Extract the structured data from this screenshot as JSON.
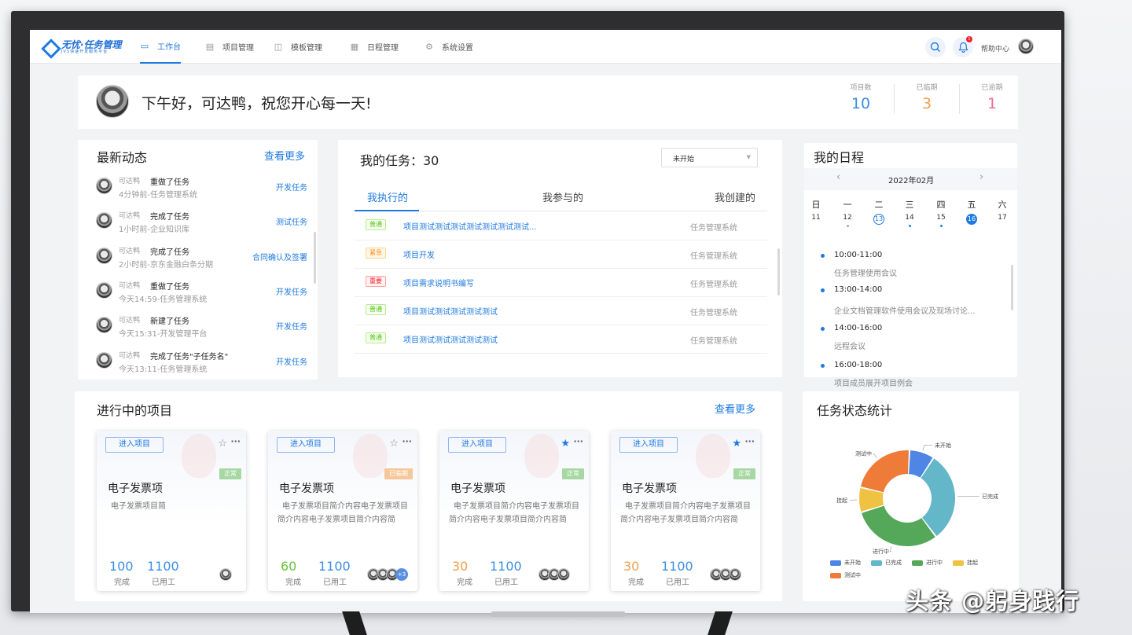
{
  "brand": {
    "name": "无忧·任务管理",
    "sub": "JVS快速开发服务平台"
  },
  "nav": [
    {
      "label": "工作台",
      "icon": "dashboard-icon",
      "active": true
    },
    {
      "label": "项目管理",
      "icon": "clipboard-icon"
    },
    {
      "label": "模板管理",
      "icon": "template-icon"
    },
    {
      "label": "日程管理",
      "icon": "calendar-icon"
    },
    {
      "label": "系统设置",
      "icon": "gear-icon"
    }
  ],
  "header": {
    "help": "帮助中心",
    "notif_count": "1"
  },
  "greeting": {
    "text": "下午好，可达鸭，祝您开心每一天!"
  },
  "stats": [
    {
      "label": "项目数",
      "value": "10",
      "color": "#3a8ee6"
    },
    {
      "label": "已临期",
      "value": "3",
      "color": "#f0a04b"
    },
    {
      "label": "已逾期",
      "value": "1",
      "color": "#f06c8f"
    }
  ],
  "news": {
    "title": "最新动态",
    "more": "查看更多",
    "items": [
      {
        "user": "可达鸭",
        "action": "重做了任务",
        "sub": "4分钟前-任务管理系统",
        "tag": "开发任务"
      },
      {
        "user": "可达鸭",
        "action": "完成了任务",
        "sub": "1小时前-企业知识库",
        "tag": "测试任务"
      },
      {
        "user": "可达鸭",
        "action": "完成了任务",
        "sub": "2小时前-京东金融白条分期",
        "tag": "合同确认及签署"
      },
      {
        "user": "可达鸭",
        "action": "重做了任务",
        "sub": "今天14:59-任务管理系统",
        "tag": "开发任务"
      },
      {
        "user": "可达鸭",
        "action": "新建了任务",
        "sub": "今天15:31-开发管理平台",
        "tag": "开发任务"
      },
      {
        "user": "可达鸭",
        "action": "完成了任务\"子任务名\"",
        "sub": "今天13:11-任务管理系统",
        "tag": "开发任务"
      }
    ]
  },
  "tasks": {
    "title": "我的任务：30",
    "filter": "未开始",
    "tabs": [
      "我执行的",
      "我参与的",
      "我创建的"
    ],
    "rows": [
      {
        "tag": "普通",
        "type": "norm",
        "name": "项目测试测试测试测试测试测试测试...",
        "project": "任务管理系统"
      },
      {
        "tag": "紧急",
        "type": "urg",
        "name": "项目开发",
        "project": "任务管理系统"
      },
      {
        "tag": "重要",
        "type": "imp",
        "name": "项目需求说明书编写",
        "project": "任务管理系统"
      },
      {
        "tag": "普通",
        "type": "norm",
        "name": "项目测试测试测试测试测试",
        "project": "任务管理系统"
      },
      {
        "tag": "普通",
        "type": "norm",
        "name": "项目测试测试测试测试测试",
        "project": "任务管理系统"
      }
    ]
  },
  "schedule": {
    "title": "我的日程",
    "month": "2022年02月",
    "weekdays": [
      "日",
      "一",
      "二",
      "三",
      "四",
      "五",
      "六"
    ],
    "days": [
      "11",
      "12",
      "13",
      "14",
      "15",
      "16",
      "17"
    ],
    "today": "13",
    "selected": "16",
    "events": [
      {
        "time": "10:00-11:00",
        "name": "任务管理使用会议"
      },
      {
        "time": "13:00-14:00",
        "name": "企业文档管理软件使用会议及现场讨论..."
      },
      {
        "time": "14:00-16:00",
        "name": "远程会议"
      },
      {
        "time": "16:00-18:00",
        "name": "项目成员展开项目例会"
      }
    ]
  },
  "projects": {
    "title": "进行中的项目",
    "more": "查看更多",
    "enter": "进入项目",
    "done_label": "完成",
    "used_label": "已用工",
    "cards": [
      {
        "name": "电子发票项",
        "desc1": "电子发票项目简",
        "desc2": "",
        "status": "正常",
        "status_type": "ok",
        "starred": false,
        "done": "100",
        "done_color": "#3a8ee6",
        "used": "1100",
        "avatars": 1,
        "extra": ""
      },
      {
        "name": "电子发票项",
        "desc1": "电子发票项目简介内容电子发票项目",
        "desc2": "简介内容电子发票项目简介内容简",
        "status": "已临期",
        "status_type": "late",
        "starred": false,
        "done": "60",
        "done_color": "#67c23a",
        "used": "1100",
        "avatars": 3,
        "extra": "+3"
      },
      {
        "name": "电子发票项",
        "desc1": "电子发票项目简介内容电子发票项目",
        "desc2": "简介内容电子发票项目简介内容简",
        "status": "正常",
        "status_type": "ok",
        "starred": true,
        "done": "30",
        "done_color": "#f0a04b",
        "used": "1100",
        "avatars": 3,
        "extra": ""
      },
      {
        "name": "电子发票项",
        "desc1": "电子发票项目简介内容电子发票项目",
        "desc2": "简介内容电子发票项目简介内容简",
        "status": "正常",
        "status_type": "ok",
        "starred": true,
        "done": "30",
        "done_color": "#f0a04b",
        "used": "1100",
        "avatars": 3,
        "extra": ""
      }
    ]
  },
  "task_stats": {
    "title": "任务状态统计",
    "chart_data": {
      "type": "pie",
      "categories": [
        "未开始",
        "已完成",
        "进行中",
        "挂起",
        "测试中"
      ],
      "values": [
        8,
        29,
        29,
        8,
        21
      ],
      "colors": [
        "#4f86e6",
        "#63b7c9",
        "#55a85a",
        "#f0c244",
        "#ee7b37"
      ],
      "legend": "bottom"
    }
  },
  "watermark": "头条 @躬身践行"
}
